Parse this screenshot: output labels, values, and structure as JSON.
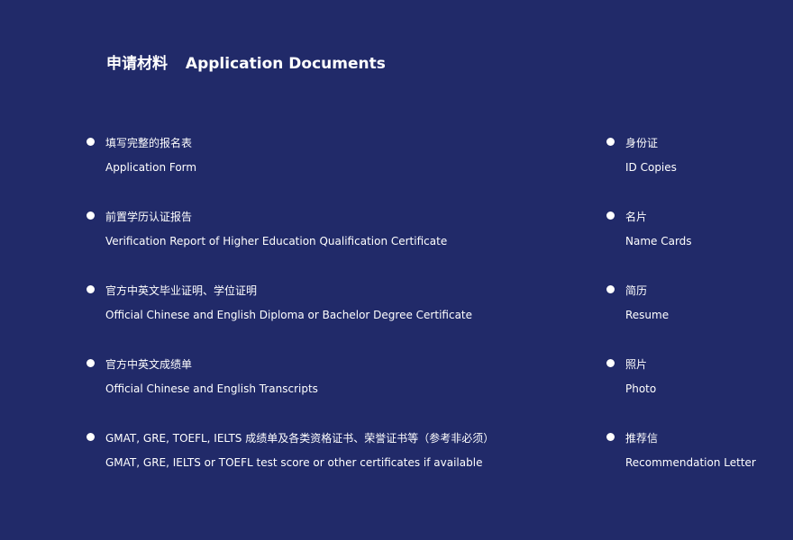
{
  "title": {
    "zh": "申请材料",
    "en": "Application Documents"
  },
  "left_items": [
    {
      "zh": "填写完整的报名表",
      "en": "Application Form"
    },
    {
      "zh": "前置学历认证报告",
      "en": "Verification Report of Higher Education Qualification Certificate"
    },
    {
      "zh": "官方中英文毕业证明、学位证明",
      "en": "Official Chinese and English Diploma or Bachelor Degree Certificate"
    },
    {
      "zh": "官方中英文成绩单",
      "en": "Official Chinese and English Transcripts"
    },
    {
      "zh": "GMAT, GRE, TOEFL, IELTS 成绩单及各类资格证书、荣誉证书等（参考非必须）",
      "en": "GMAT, GRE, IELTS or TOEFL test score or other certificates if available"
    }
  ],
  "right_items": [
    {
      "zh": "身份证",
      "en": "ID Copies"
    },
    {
      "zh": "名片",
      "en": "Name Cards"
    },
    {
      "zh": "简历",
      "en": "Resume"
    },
    {
      "zh": "照片",
      "en": "Photo"
    },
    {
      "zh": "推荐信",
      "en": "Recommendation Letter"
    }
  ]
}
